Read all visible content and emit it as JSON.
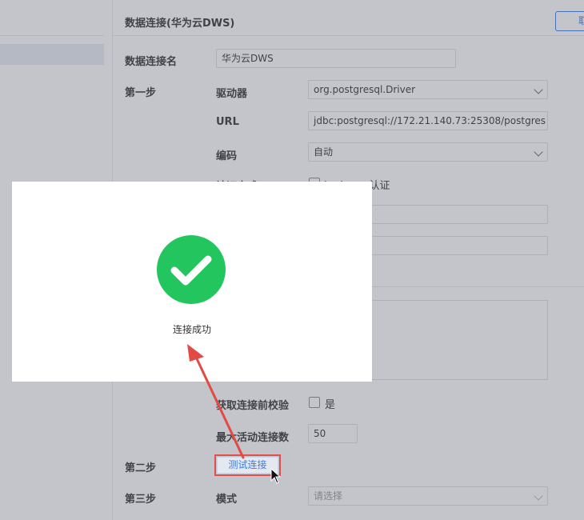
{
  "header": {
    "title": "数据连接(华为云DWS)",
    "cancel_label": "取消"
  },
  "form": {
    "name_label": "数据连接名",
    "name_value": "华为云DWS",
    "step1_label": "第一步",
    "driver_label": "驱动器",
    "driver_value": "org.postgresql.Driver",
    "url_label": "URL",
    "url_value": "jdbc:postgresql://172.21.140.73:25308/postgres",
    "encoding_label": "编码",
    "encoding_value": "自动",
    "auth_label": "认证方式",
    "kerberos_label": "kerberos认证",
    "validate_label": "获取连接前校验",
    "validate_value": "是",
    "max_active_label": "最大活动连接数",
    "max_active_value": "50",
    "step2_label": "第二步",
    "test_button_label": "测试连接",
    "step3_label": "第三步",
    "mode_label": "模式",
    "mode_placeholder": "请选择"
  },
  "modal": {
    "message": "连接成功",
    "icon": "check-circle-icon",
    "icon_color": "#23c55e"
  },
  "annotation": {
    "arrow_color": "#e24b45",
    "highlight_color": "#e05050"
  }
}
